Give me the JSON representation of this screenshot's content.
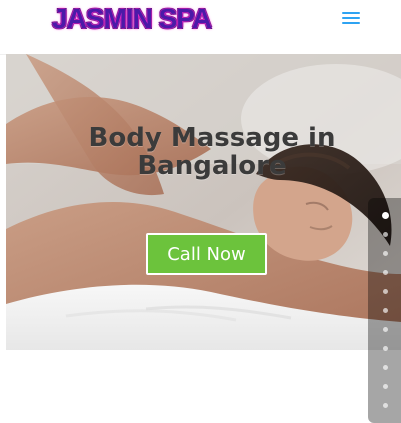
{
  "header": {
    "logo_text": "JASMIN SPA",
    "menu_icon": "hamburger-menu-icon"
  },
  "hero": {
    "title": "Body Massage in Bangalore",
    "cta_label": "Call Now"
  },
  "side_nav": {
    "dot_count": 12,
    "active_index": 0
  },
  "colors": {
    "accent_blue": "#2ea3f2",
    "cta_green": "#6cc33c",
    "logo_purple": "#4b1aa8",
    "logo_glow": "#ff2bd6",
    "title_text": "#3b3b3b"
  }
}
